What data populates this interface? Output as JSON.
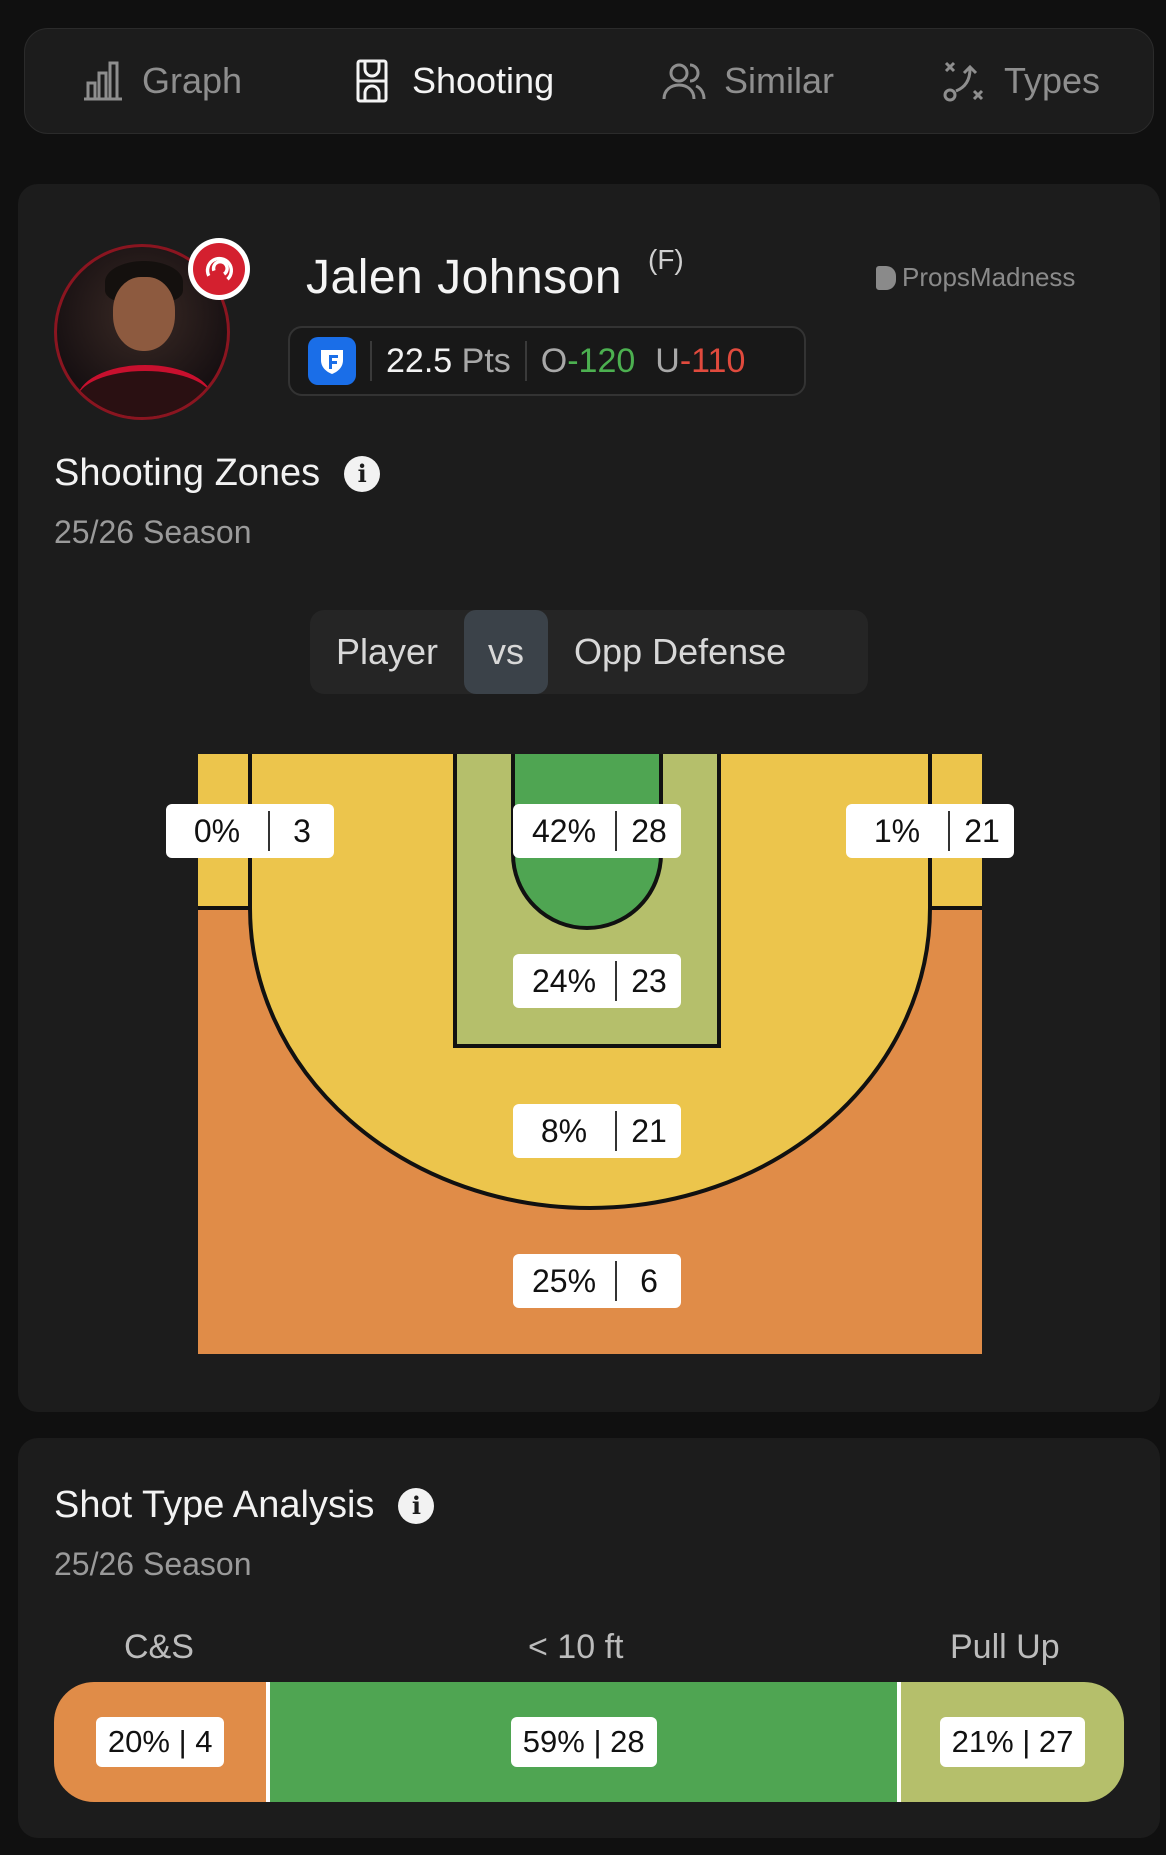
{
  "tabs": [
    {
      "label": "Graph",
      "icon": "bar-chart-icon",
      "active": false
    },
    {
      "label": "Shooting",
      "icon": "court-icon",
      "active": true
    },
    {
      "label": "Similar",
      "icon": "users-icon",
      "active": false
    },
    {
      "label": "Types",
      "icon": "play-diagram-icon",
      "active": false
    }
  ],
  "player": {
    "name": "Jalen Johnson",
    "position": "(F)",
    "team_logo": "atlanta-hawks-logo"
  },
  "brand": "PropsMadness",
  "line": {
    "book_icon": "fanduel-icon",
    "value": "22.5",
    "stat": "Pts",
    "over_label": "O",
    "over_odds": "-120",
    "under_label": "U",
    "under_odds": "-110"
  },
  "zones_section": {
    "title": "Shooting Zones",
    "subtitle": "25/26 Season",
    "toggle": {
      "left": "Player",
      "middle": "vs",
      "right": "Opp Defense"
    },
    "zones": [
      {
        "id": "left-corner-three",
        "pct": "0%",
        "count": "3"
      },
      {
        "id": "restricted-area",
        "pct": "42%",
        "count": "28"
      },
      {
        "id": "right-corner-three",
        "pct": "1%",
        "count": "21"
      },
      {
        "id": "paint-non-ra",
        "pct": "24%",
        "count": "23"
      },
      {
        "id": "mid-range",
        "pct": "8%",
        "count": "21"
      },
      {
        "id": "above-break-three",
        "pct": "25%",
        "count": "6"
      }
    ],
    "colors": {
      "yellow": "#ecc54c",
      "orange": "#e08c48",
      "olive": "#b5bf6b",
      "green": "#4fa552"
    }
  },
  "shot_type_section": {
    "title": "Shot Type Analysis",
    "subtitle": "25/26 Season",
    "types": [
      {
        "label": "C&S",
        "text": "20% | 4",
        "share": 0.2,
        "color": "#e08c48"
      },
      {
        "label": "< 10 ft",
        "text": "59% | 28",
        "share": 0.59,
        "color": "#4fa552"
      },
      {
        "label": "Pull Up",
        "text": "21% | 27",
        "share": 0.21,
        "color": "#b5bf6b"
      }
    ]
  }
}
